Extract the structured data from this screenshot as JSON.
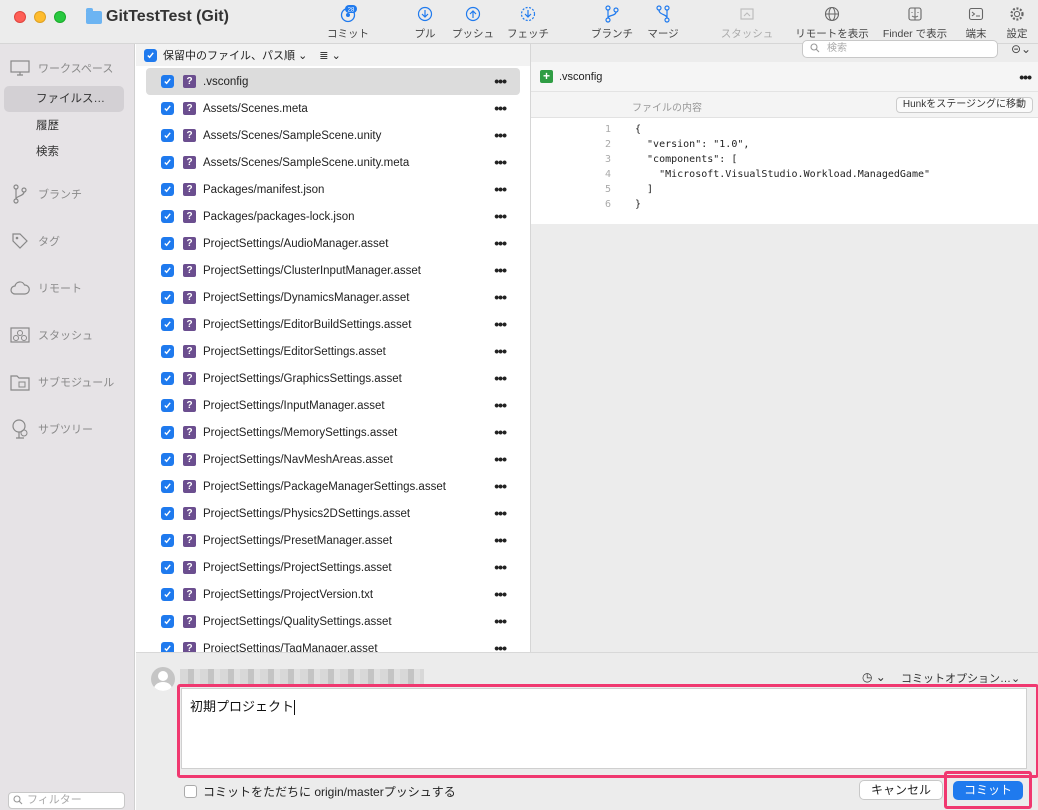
{
  "window": {
    "title": "GitTestTest (Git)"
  },
  "toolbar": {
    "commit_label": "コミット",
    "commit_badge": "28",
    "pull_label": "プル",
    "push_label": "プッシュ",
    "fetch_label": "フェッチ",
    "branch_label": "ブランチ",
    "merge_label": "マージ",
    "stash_label": "スタッシュ",
    "remote_label": "リモートを表示",
    "finder_label": "Finder で表示",
    "terminal_label": "端末",
    "settings_label": "設定"
  },
  "sidebar": {
    "workspace": "ワークスペース",
    "workspace_items": [
      "ファイルス…",
      "履歴",
      "検索"
    ],
    "branches": "ブランチ",
    "tags": "タグ",
    "remotes": "リモート",
    "stashes": "スタッシュ",
    "submodules": "サブモジュール",
    "subtrees": "サブツリー",
    "filter_placeholder": "フィルター"
  },
  "file_list": {
    "header": "保留中のファイル、パス順",
    "files": [
      ".vsconfig",
      "Assets/Scenes.meta",
      "Assets/Scenes/SampleScene.unity",
      "Assets/Scenes/SampleScene.unity.meta",
      "Packages/manifest.json",
      "Packages/packages-lock.json",
      "ProjectSettings/AudioManager.asset",
      "ProjectSettings/ClusterInputManager.asset",
      "ProjectSettings/DynamicsManager.asset",
      "ProjectSettings/EditorBuildSettings.asset",
      "ProjectSettings/EditorSettings.asset",
      "ProjectSettings/GraphicsSettings.asset",
      "ProjectSettings/InputManager.asset",
      "ProjectSettings/MemorySettings.asset",
      "ProjectSettings/NavMeshAreas.asset",
      "ProjectSettings/PackageManagerSettings.asset",
      "ProjectSettings/Physics2DSettings.asset",
      "ProjectSettings/PresetManager.asset",
      "ProjectSettings/ProjectSettings.asset",
      "ProjectSettings/ProjectVersion.txt",
      "ProjectSettings/QualitySettings.asset",
      "ProjectSettings/TagManager.asset"
    ],
    "status_icon": "?",
    "more": "•••"
  },
  "diff": {
    "search_placeholder": "検索",
    "file_title": ".vsconfig",
    "hunk_title": "ファイルの内容",
    "hunk_button": "Hunkをステージングに移動",
    "lines": [
      {
        "n": "1",
        "text": "{"
      },
      {
        "n": "2",
        "text": "  \"version\": \"1.0\","
      },
      {
        "n": "3",
        "text": "  \"components\": ["
      },
      {
        "n": "4",
        "text": "    \"Microsoft.VisualStudio.Workload.ManagedGame\""
      },
      {
        "n": "5",
        "text": "  ]"
      },
      {
        "n": "6",
        "text": "}"
      }
    ]
  },
  "commit": {
    "options_label": "コミットオプション…",
    "message": "初期プロジェクト",
    "push_checkbox_label": "コミットをただちに origin/masterプッシュする",
    "cancel_label": "キャンセル",
    "commit_label": "コミット"
  },
  "colors": {
    "accent": "#1f7aee",
    "highlight": "#f03870",
    "untracked": "#6b4e8f"
  }
}
